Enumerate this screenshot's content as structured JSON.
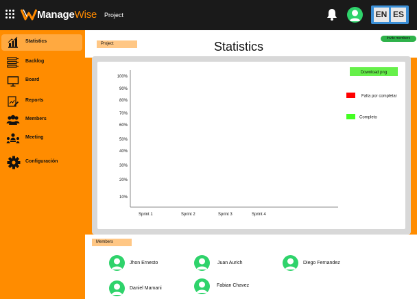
{
  "header": {
    "brand_main": "Manage",
    "brand_accent": "Wise",
    "nav_project": "Project",
    "languages": [
      "EN",
      "ES"
    ]
  },
  "sidebar": {
    "items": [
      {
        "label": "Statistics",
        "icon": "bar-chart-icon",
        "active": true
      },
      {
        "label": "Backlog",
        "icon": "backlog-icon",
        "active": false
      },
      {
        "label": "Board",
        "icon": "monitor-icon",
        "active": false
      },
      {
        "label": "Reports",
        "icon": "report-icon",
        "active": false
      },
      {
        "label": "Members",
        "icon": "users-icon",
        "active": false
      },
      {
        "label": "Meeting",
        "icon": "meeting-icon",
        "active": false
      },
      {
        "label": "Configuración",
        "icon": "gear-icon",
        "active": false
      }
    ]
  },
  "main": {
    "project_chip": "Project",
    "title": "Statistics",
    "invite_label": "Invite members",
    "download_label": "Download png",
    "members_chip": "Members",
    "members": [
      "Jhon Ernesto",
      "Juan Aurich",
      "Diego Fernandez",
      "Daniel Mamani",
      "Fabian Chavez"
    ]
  },
  "colors": {
    "accent": "#ff8c00",
    "topbar": "#1a1a1a",
    "success": "#2eb24a",
    "pending": "#ff0000",
    "complete": "#44ff22"
  },
  "chart_data": {
    "type": "bar",
    "categories": [
      "Sprint 1",
      "Sprint 2",
      "Sprint 3",
      "Sprint 4"
    ],
    "yticks": [
      "100%",
      "90%",
      "80%",
      "70%",
      "60%",
      "50%",
      "40%",
      "30%",
      "20%",
      "10%"
    ],
    "series": [
      {
        "name": "Falta por completar",
        "color": "#ff0000",
        "values": []
      },
      {
        "name": "Completo",
        "color": "#44ff22",
        "values": []
      }
    ],
    "ylim": [
      0,
      100
    ],
    "legend": "right"
  }
}
